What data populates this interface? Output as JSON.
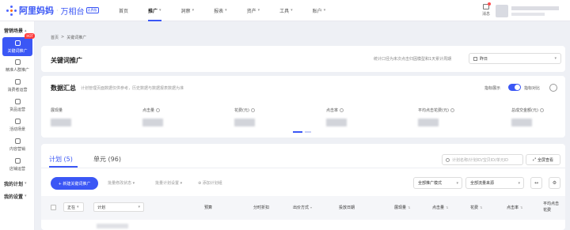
{
  "brand": {
    "name": "阿里妈妈",
    "separator": "·",
    "product": "万相台",
    "badge": "无界版"
  },
  "nav": [
    {
      "label": "首页",
      "active": false,
      "caret": false
    },
    {
      "label": "推广",
      "active": true,
      "caret": true
    },
    {
      "label": "洞察",
      "active": false,
      "caret": true
    },
    {
      "label": "报表",
      "active": false,
      "caret": true
    },
    {
      "label": "资产",
      "active": false,
      "caret": true
    },
    {
      "label": "工具",
      "active": false,
      "caret": true
    },
    {
      "label": "账户",
      "active": false,
      "caret": true
    }
  ],
  "header": {
    "message_label": "消息"
  },
  "sidebar": {
    "section": "营销场景",
    "items": [
      {
        "label": "关键词推广",
        "active": true,
        "badge": "HOT"
      },
      {
        "label": "精准人群推广",
        "active": false
      },
      {
        "label": "消费者运营",
        "active": false
      },
      {
        "label": "货品运营",
        "active": false
      },
      {
        "label": "活动场景",
        "active": false
      },
      {
        "label": "内容营销",
        "active": false
      },
      {
        "label": "店铺运营",
        "active": false
      }
    ],
    "groups": [
      "我的计划",
      "我的设置"
    ]
  },
  "breadcrumb": {
    "home": "首页",
    "sep": ">",
    "current": "关键词推广"
  },
  "page": {
    "title": "关键词推广",
    "stat_note": "统计口径为未次点击归因模型和1天累计周期",
    "date_value": "昨日"
  },
  "summary": {
    "title": "数据汇总",
    "desc": "计划管理页面数据仅供参考，历史数据与数据报表数据为准",
    "metric_toggle_label": "指标展示",
    "compare_label": "指标对比",
    "metrics": [
      {
        "label": "展现量"
      },
      {
        "label": "点击量"
      },
      {
        "label": "花费(元)"
      },
      {
        "label": "点击率"
      },
      {
        "label": "平均点击花费(元)"
      },
      {
        "label": "总成交金额(元)"
      }
    ]
  },
  "table": {
    "tabs": [
      {
        "label": "计划 (5)",
        "active": true
      },
      {
        "label": "单元 (96)",
        "active": false
      }
    ],
    "search_placeholder": "计划名称/计划ID/宝贝ID/单元ID",
    "all_view": "全屏查看",
    "new_button": "+ 新建关键词推广",
    "tools": [
      "批量修改状态",
      "批量计划设置",
      "添加计划组"
    ],
    "filters": [
      "全部推广模式",
      "全部流量来源"
    ],
    "columns": {
      "status": "正在",
      "plan": "计划",
      "budget": "预算",
      "time": "分时折扣",
      "bid_method": "出价方式",
      "date": "投放日期",
      "impressions": "展现量",
      "clicks": "点击量",
      "cost": "花费",
      "ctr": "点击率",
      "avg_cost": "平均点击花费"
    }
  },
  "colors": {
    "accent": "#3b57f5",
    "hot": "#ff3b3b"
  }
}
